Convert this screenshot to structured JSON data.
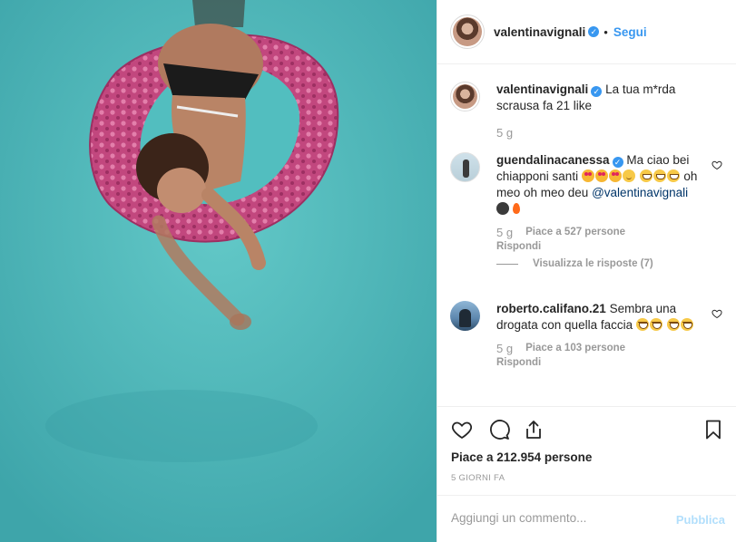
{
  "post_image": {
    "description_icon": "pool-photo"
  },
  "header": {
    "username": "valentinavignali",
    "verified_icon": "verified-badge-icon",
    "separator": "•",
    "follow_label": "Segui"
  },
  "caption": {
    "username": "valentinavignali",
    "text": "La tua m*rda scrausa fa 21 like",
    "time": "5 g"
  },
  "comments": [
    {
      "username": "guendalinacanessa",
      "text_a": "Ma ciao bei chiapponi santi",
      "text_b": "oh meo oh meo deu",
      "mention": "@valentinavignali",
      "time": "5 g",
      "likes": "Piace a 527 persone",
      "reply": "Rispondi",
      "view_replies": "Visualizza le risposte (7)"
    },
    {
      "username": "roberto.califano.21",
      "text_a": "Sembra una drogata con quella faccia",
      "time": "5 g",
      "likes": "Piace a 103 persone",
      "reply": "Rispondi"
    }
  ],
  "actions": {
    "like_icon": "heart-icon",
    "comment_icon": "comment-icon",
    "share_icon": "share-icon",
    "save_icon": "bookmark-icon"
  },
  "likes_total": "Piace a 212.954 persone",
  "age": "5 GIORNI FA",
  "add_comment": {
    "placeholder": "Aggiungi un commento...",
    "publish_label": "Pubblica"
  },
  "colors": {
    "link_blue": "#3897f0",
    "publish_disabled": "#b2dffc",
    "muted": "#999999",
    "pool": "#4fbcbd",
    "float_pink": "#c44f84"
  }
}
